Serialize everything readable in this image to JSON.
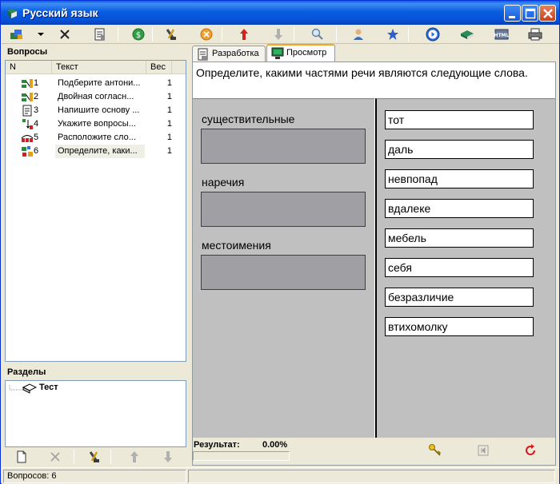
{
  "window": {
    "title": "Русский язык"
  },
  "panels": {
    "questions_label": "Вопросы",
    "sections_label": "Разделы"
  },
  "questions": {
    "columns": {
      "n": "N",
      "text": "Текст",
      "weight": "Вес"
    },
    "rows": [
      {
        "n": "1",
        "text": "Подберите антони...",
        "weight": "1",
        "icon": "matching-icon"
      },
      {
        "n": "2",
        "text": "Двойная согласн...",
        "weight": "1",
        "icon": "matching-icon"
      },
      {
        "n": "3",
        "text": "Напишите основу ...",
        "weight": "1",
        "icon": "text-entry-icon"
      },
      {
        "n": "4",
        "text": "Укажите вопросы...",
        "weight": "1",
        "icon": "ordering-icon"
      },
      {
        "n": "5",
        "text": "Расположите сло...",
        "weight": "1",
        "icon": "sequence-icon"
      },
      {
        "n": "6",
        "text": "Определите, каки...",
        "weight": "1",
        "icon": "classification-icon"
      }
    ]
  },
  "sections": {
    "root": "Тест"
  },
  "tabs": {
    "develop": "Разработка",
    "preview": "Просмотр"
  },
  "preview": {
    "question": "Определите, какими частями речи являются следующие слова.",
    "categories": [
      "существительные",
      "наречия",
      "местоимения"
    ],
    "words": [
      "тот",
      "даль",
      "невпопад",
      "вдалеке",
      "мебель",
      "себя",
      "безразличие",
      "втихомолку"
    ],
    "result_label": "Результат:",
    "result_value": "0.00%",
    "progress_fraction": 0
  },
  "statusbar": {
    "count": "Вопросов: 6"
  }
}
